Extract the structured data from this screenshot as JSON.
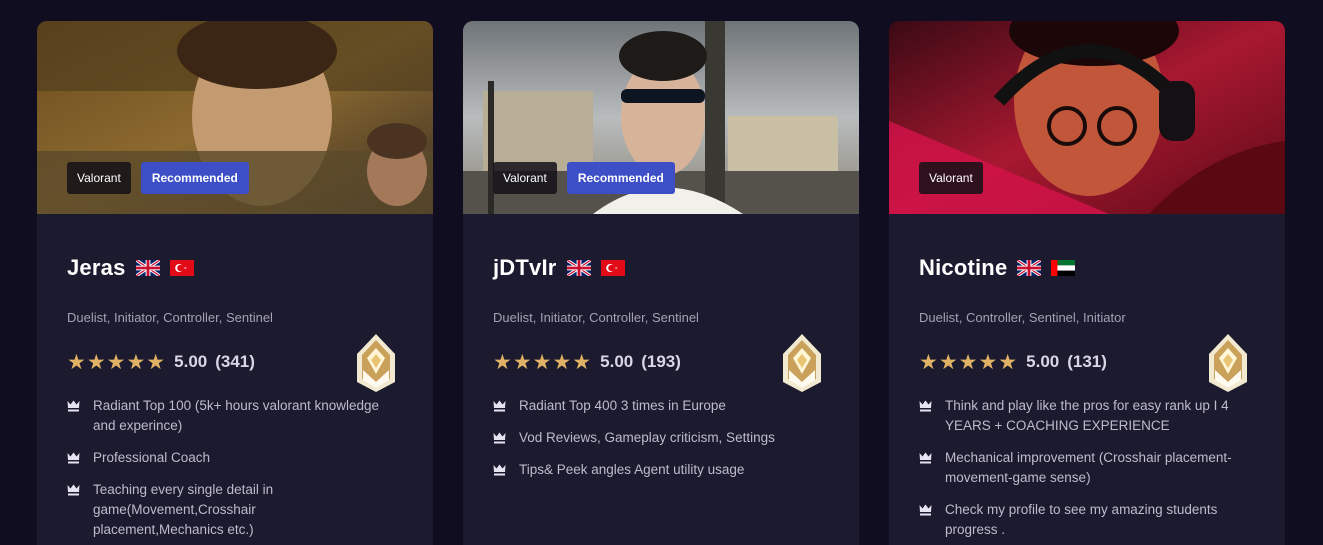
{
  "cards": [
    {
      "name": "Jeras",
      "game_tag": "Valorant",
      "badge": "Recommended",
      "roles": "Duelist, Initiator, Controller, Sentinel",
      "stars": "★★★★★",
      "score": "5.00",
      "reviews": "(341)",
      "flags": [
        "uk-flag",
        "turkey-flag"
      ],
      "features": [
        "Radiant Top 100 (5k+ hours valorant knowledge and experince)",
        "Professional Coach",
        "Teaching every single detail in game(Movement,Crosshair placement,Mechanics etc.)"
      ]
    },
    {
      "name": "jDTvIr",
      "game_tag": "Valorant",
      "badge": "Recommended",
      "roles": "Duelist, Initiator, Controller, Sentinel",
      "stars": "★★★★★",
      "score": "5.00",
      "reviews": "(193)",
      "flags": [
        "uk-flag",
        "turkey-flag"
      ],
      "features": [
        "Radiant Top 400 3 times in Europe",
        "Vod Reviews, Gameplay criticism, Settings",
        "Tips& Peek angles Agent utility usage"
      ]
    },
    {
      "name": "Nicotine",
      "game_tag": "Valorant",
      "roles": "Duelist, Controller, Sentinel, Initiator",
      "stars": "★★★★★",
      "score": "5.00",
      "reviews": "(131)",
      "flags": [
        "uk-flag",
        "uae-flag"
      ],
      "features": [
        "Think and play like the pros for easy rank up I 4 YEARS + COACHING EXPERIENCE",
        "Mechanical improvement (Crosshair placement-movement-game sense)",
        "Check my profile to see my amazing students progress ."
      ]
    }
  ],
  "colors": {
    "background": "#0f0d1f",
    "card": "#1c1a2e",
    "recommended": "#3d4fc7",
    "star": "#e0b266"
  },
  "icons": {
    "feature": "crown-icon",
    "rank": "radiant-rank-icon"
  }
}
